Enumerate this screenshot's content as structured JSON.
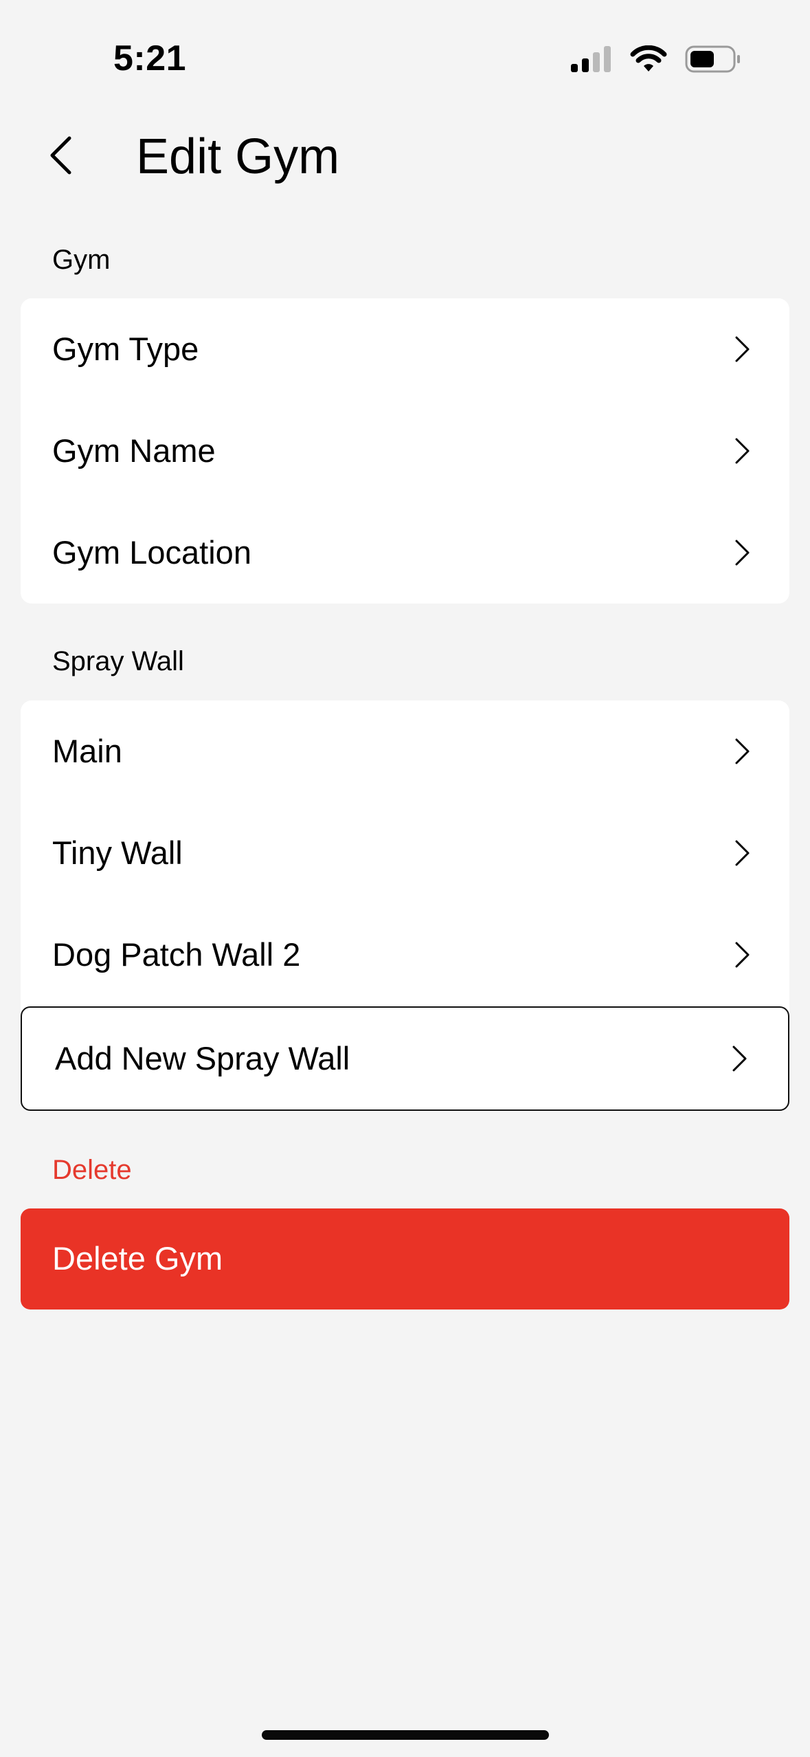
{
  "status_bar": {
    "time": "5:21",
    "icons": [
      "cellular-signal-icon",
      "wifi-icon",
      "battery-icon"
    ]
  },
  "header": {
    "back_icon": "chevron-left-icon",
    "title": "Edit Gym"
  },
  "sections": {
    "gym": {
      "label": "Gym",
      "items": [
        {
          "label": "Gym Type"
        },
        {
          "label": "Gym Name"
        },
        {
          "label": "Gym Location"
        }
      ]
    },
    "spray_wall": {
      "label": "Spray Wall",
      "items": [
        {
          "label": "Main"
        },
        {
          "label": "Tiny Wall"
        },
        {
          "label": "Dog Patch Wall 2"
        }
      ],
      "add_label": "Add New Spray Wall"
    },
    "delete": {
      "label": "Delete",
      "button_label": "Delete Gym"
    }
  },
  "colors": {
    "background": "#f4f4f4",
    "card": "#ffffff",
    "danger": "#e93326",
    "danger_text": "#e53a2e"
  }
}
